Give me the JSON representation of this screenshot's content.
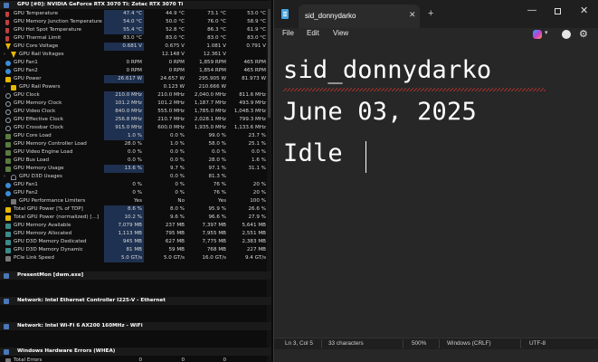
{
  "sensors": {
    "groups": [
      {
        "title": "GPU [#0]: NVIDIA GeForce RTX 3070 Ti: Zotac RTX 3070 Ti",
        "rows": [
          {
            "label": "GPU Temperature",
            "icon": "therm",
            "cur": "47.4 °C",
            "min": "44.9 °C",
            "max": "73.1 °C",
            "avg": "53.0 °C",
            "hl": true
          },
          {
            "label": "GPU Memory Junction Temperature",
            "icon": "therm",
            "cur": "54.0 °C",
            "min": "50.0 °C",
            "max": "76.0 °C",
            "avg": "58.9 °C",
            "hl": true
          },
          {
            "label": "GPU Hot Spot Temperature",
            "icon": "therm",
            "cur": "55.4 °C",
            "min": "52.8 °C",
            "max": "86.3 °C",
            "avg": "61.9 °C",
            "hl": true
          },
          {
            "label": "GPU Thermal Limit",
            "icon": "therm",
            "cur": "83.0 °C",
            "min": "83.0 °C",
            "max": "83.0 °C",
            "avg": "83.0 °C",
            "hl": false
          },
          {
            "label": "GPU Core Voltage",
            "icon": "volt",
            "cur": "0.681 V",
            "min": "0.675 V",
            "max": "1.081 V",
            "avg": "0.791 V",
            "hl": true
          },
          {
            "label": "GPU Rail Voltages",
            "icon": "volt",
            "cur": "",
            "min": "12.148 V",
            "max": "12.361 V",
            "avg": "",
            "hl": false,
            "sub": true
          },
          {
            "label": "GPU Fan1",
            "icon": "fan",
            "cur": "0 RPM",
            "min": "0 RPM",
            "max": "1,859 RPM",
            "avg": "465 RPM",
            "hl": false
          },
          {
            "label": "GPU Fan2",
            "icon": "fan",
            "cur": "0 RPM",
            "min": "0 RPM",
            "max": "1,854 RPM",
            "avg": "465 RPM",
            "hl": false
          },
          {
            "label": "GPU Power",
            "icon": "power",
            "cur": "26.617 W",
            "min": "24.657 W",
            "max": "295.905 W",
            "avg": "81.973 W",
            "hl": true
          },
          {
            "label": "GPU Rail Powers",
            "icon": "power",
            "cur": "",
            "min": "0.123 W",
            "max": "210.666 W",
            "avg": "",
            "hl": false,
            "sub": true
          },
          {
            "label": "GPU Clock",
            "icon": "clock",
            "cur": "210.0 MHz",
            "min": "210.0 MHz",
            "max": "2,040.0 MHz",
            "avg": "811.6 MHz",
            "hl": true
          },
          {
            "label": "GPU Memory Clock",
            "icon": "clock",
            "cur": "101.2 MHz",
            "min": "101.2 MHz",
            "max": "1,187.7 MHz",
            "avg": "493.9 MHz",
            "hl": true
          },
          {
            "label": "GPU Video Clock",
            "icon": "clock",
            "cur": "840.0 MHz",
            "min": "555.0 MHz",
            "max": "1,785.0 MHz",
            "avg": "1,048.3 MHz",
            "hl": true
          },
          {
            "label": "GPU Effective Clock",
            "icon": "clock",
            "cur": "256.8 MHz",
            "min": "210.7 MHz",
            "max": "2,028.1 MHz",
            "avg": "799.3 MHz",
            "hl": true
          },
          {
            "label": "GPU Crossbar Clock",
            "icon": "clock",
            "cur": "915.0 MHz",
            "min": "600.0 MHz",
            "max": "1,935.0 MHz",
            "avg": "1,133.6 MHz",
            "hl": true
          },
          {
            "label": "GPU Core Load",
            "icon": "load",
            "cur": "1.0 %",
            "min": "0.0 %",
            "max": "99.0 %",
            "avg": "23.7 %",
            "hl": true
          },
          {
            "label": "GPU Memory Controller Load",
            "icon": "load",
            "cur": "28.0 %",
            "min": "1.0 %",
            "max": "58.0 %",
            "avg": "25.1 %",
            "hl": false
          },
          {
            "label": "GPU Video Engine Load",
            "icon": "load",
            "cur": "0.0 %",
            "min": "0.0 %",
            "max": "0.0 %",
            "avg": "0.0 %",
            "hl": false
          },
          {
            "label": "GPU Bus Load",
            "icon": "load",
            "cur": "0.0 %",
            "min": "0.0 %",
            "max": "28.0 %",
            "avg": "1.6 %",
            "hl": false
          },
          {
            "label": "GPU Memory Usage",
            "icon": "load",
            "cur": "13.6 %",
            "min": "9.7 %",
            "max": "97.1 %",
            "avg": "31.1 %",
            "hl": true
          },
          {
            "label": "GPU D3D Usages",
            "icon": "usage",
            "cur": "",
            "min": "0.0 %",
            "max": "81.3 %",
            "avg": "",
            "hl": false,
            "sub": true
          },
          {
            "label": "GPU Fan1",
            "icon": "fan",
            "cur": "0 %",
            "min": "0 %",
            "max": "76 %",
            "avg": "20 %",
            "hl": false
          },
          {
            "label": "GPU Fan2",
            "icon": "fan",
            "cur": "0 %",
            "min": "0 %",
            "max": "76 %",
            "avg": "20 %",
            "hl": false
          },
          {
            "label": "GPU Performance Limiters",
            "icon": "other",
            "cur": "Yes",
            "min": "No",
            "max": "Yes",
            "avg": "100 %",
            "hl": false,
            "sub": true
          },
          {
            "label": "Total GPU Power [% of TDP]",
            "icon": "power",
            "cur": "8.6 %",
            "min": "8.0 %",
            "max": "95.9 %",
            "avg": "26.6 %",
            "hl": true
          },
          {
            "label": "Total GPU Power (normalized) [...]",
            "icon": "power",
            "cur": "10.2 %",
            "min": "9.6 %",
            "max": "96.6 %",
            "avg": "27.9 %",
            "hl": true
          },
          {
            "label": "GPU Memory Available",
            "icon": "mem",
            "cur": "7,079 MB",
            "min": "237 MB",
            "max": "7,397 MB",
            "avg": "5,641 MB",
            "hl": true
          },
          {
            "label": "GPU Memory Allocated",
            "icon": "mem",
            "cur": "1,113 MB",
            "min": "795 MB",
            "max": "7,955 MB",
            "avg": "2,551 MB",
            "hl": true
          },
          {
            "label": "GPU D3D Memory Dedicated",
            "icon": "mem",
            "cur": "945 MB",
            "min": "627 MB",
            "max": "7,775 MB",
            "avg": "2,383 MB",
            "hl": true
          },
          {
            "label": "GPU D3D Memory Dynamic",
            "icon": "mem",
            "cur": "81 MB",
            "min": "59 MB",
            "max": "768 MB",
            "avg": "227 MB",
            "hl": true
          },
          {
            "label": "PCIe Link Speed",
            "icon": "other",
            "cur": "5.0 GT/s",
            "min": "5.0 GT/s",
            "max": "16.0 GT/s",
            "avg": "9.4 GT/s",
            "hl": true
          }
        ]
      },
      {
        "title": "PresentMon [dwm.exe]",
        "rows": []
      },
      {
        "title": "Network: Intel Ethernet Controller I225-V - Ethernet",
        "rows": []
      },
      {
        "title": "Network: Intel Wi-Fi 6 AX200 160MHz - WiFi",
        "rows": []
      },
      {
        "title": "Windows Hardware Errors (WHEA)",
        "rows": [
          {
            "label": "Total Errors",
            "icon": "other",
            "cur": "0",
            "min": "0",
            "max": "0",
            "avg": "",
            "hl": false
          }
        ]
      }
    ]
  },
  "notepad": {
    "tab_title": "sid_donnydarko",
    "tab_close": "✕",
    "new_tab": "+",
    "window_controls": {
      "minimize": "—",
      "close": "✕"
    },
    "menu": {
      "file": "File",
      "edit": "Edit",
      "view": "View"
    },
    "copilot_caret": "▾",
    "settings_glyph": "⚙",
    "lines": [
      "sid_donnydarko",
      "June 03, 2025",
      "Idle"
    ],
    "status": {
      "position": "Ln 3, Col 5",
      "characters": "33 characters",
      "zoom": "500%",
      "line_ending": "Windows (CRLF)",
      "encoding": "UTF-8"
    },
    "accent_squiggle_color": "#d9332a"
  }
}
